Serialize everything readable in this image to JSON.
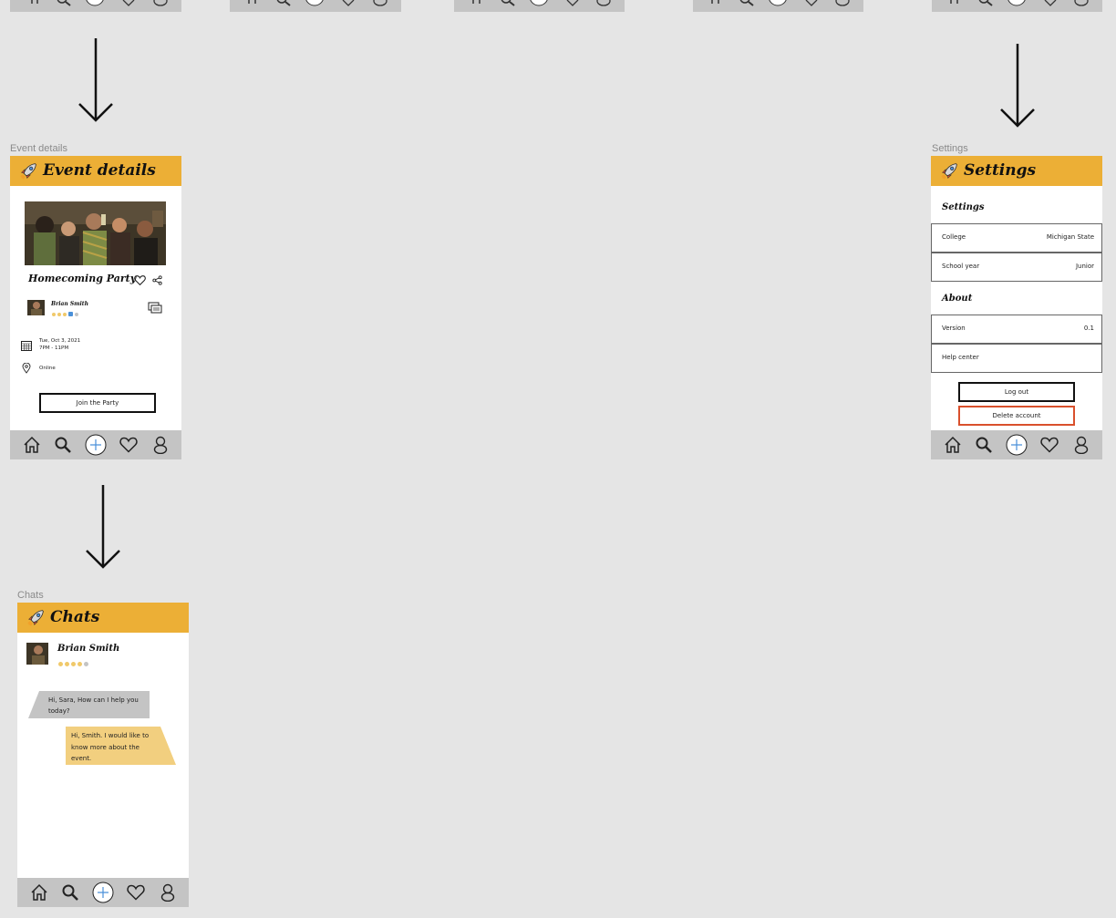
{
  "frames": {
    "event_details": {
      "label": "Event details",
      "title": "Event details",
      "event_name": "Homecoming Party",
      "host_name": "Brian Smith",
      "date_line1": "Tue, Oct 3, 2021",
      "date_line2": "7PM - 11PM",
      "location": "Online",
      "join_button": "Join the Party"
    },
    "settings": {
      "label": "Settings",
      "title": "Settings",
      "section_settings": "Settings",
      "college_label": "College",
      "college_value": "Michigan State",
      "school_year_label": "School year",
      "school_year_value": "Junior",
      "section_about": "About",
      "version_label": "Version",
      "version_value": "0.1",
      "help_center_label": "Help center",
      "logout_button": "Log out",
      "delete_button": "Delete account"
    },
    "chats": {
      "label": "Chats",
      "title": "Chats",
      "contact_name": "Brian Smith",
      "msg_received": "Hi, Sara, How can I help you today?",
      "msg_sent": "Hi, Smith. I would like to know more about the event."
    }
  },
  "colors": {
    "header_yellow": "#ecaf36",
    "navbar_gray": "#c4c4c4",
    "delete_red": "#d9502c",
    "sent_bubble": "#f2cf7f",
    "received_bubble": "#c4c4c4",
    "plus_blue": "#4a90d9"
  },
  "icons": [
    "rocket-icon",
    "home-icon",
    "search-icon",
    "plus-icon",
    "heart-icon",
    "user-icon",
    "share-icon",
    "chat-icon",
    "calendar-icon",
    "location-pin-icon"
  ]
}
